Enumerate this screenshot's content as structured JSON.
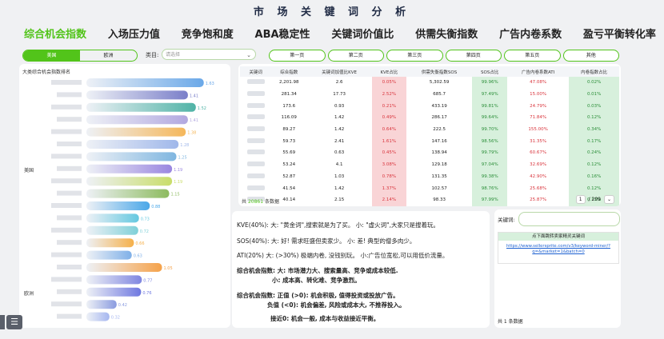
{
  "title": "市 场 关 键 词 分 析",
  "tabs": [
    "综合机会指数",
    "入场压力值",
    "竞争饱和度",
    "ABA稳定性",
    "关键词价值比",
    "供需失衡指数",
    "广告内卷系数",
    "盈亏平衡转化率"
  ],
  "region_toggle": [
    "美国",
    "欧洲"
  ],
  "category": {
    "label": "类目:",
    "placeholder": "请选择"
  },
  "pages": [
    "第一页",
    "第二页",
    "第三页",
    "第四页",
    "第五页",
    "其他"
  ],
  "colors": {
    "accent": "#52c41a",
    "pink": "#f9d4d6",
    "green": "#d7f0dc"
  },
  "chart_data": {
    "type": "bar",
    "orientation": "horizontal",
    "title": "大类综合机会指数排名",
    "groups": [
      {
        "label": "美国"
      },
      {
        "label": "欧洲"
      }
    ],
    "values": [
      1.63,
      1.41,
      1.52,
      1.41,
      1.38,
      1.28,
      1.25,
      1.19,
      1.19,
      1.15,
      0.88,
      0.73,
      0.72,
      0.66,
      0.63,
      1.05,
      0.77,
      0.76,
      0.42,
      0.32
    ],
    "xticks": [
      "0",
      "0.2",
      "0.4",
      "0.6",
      "0.8",
      "1",
      "1.2",
      "1.4",
      "1.6",
      "1.8"
    ],
    "xlim": [
      0,
      1.8
    ],
    "grid": false,
    "gradient_colors": [
      "#6aa8e8",
      "#7a7fc9",
      "#4fb3a6",
      "#b2a8e0",
      "#f5b75a",
      "#9fb7ea",
      "#7fb6e0",
      "#9a86e0",
      "#c9dd6a",
      "#8dbb5f",
      "#4aa7e8",
      "#64c8e0",
      "#7fd0d8",
      "#f5b04a",
      "#7fb0e8",
      "#f5a24a",
      "#7f86e0",
      "#6f78e0",
      "#8a9be0",
      "#a5b6f0"
    ]
  },
  "table": {
    "headers": [
      "关键词",
      "综合指数",
      "关键词加值比KVE",
      "KVE占比",
      "供需失衡指数SOS",
      "SOS占比",
      "广告内卷系数ATI",
      "内卷指数占比"
    ],
    "rows": [
      [
        "",
        "2,201.98",
        "2.6",
        "0.05%",
        "5,302.59",
        "99.96%",
        "47.08%",
        "0.02%"
      ],
      [
        "",
        "281.34",
        "17.73",
        "2.52%",
        "685.7",
        "97.49%",
        "15.00%",
        "0.01%"
      ],
      [
        "",
        "173.6",
        "0.93",
        "0.21%",
        "433.19",
        "99.81%",
        "24.79%",
        "0.03%"
      ],
      [
        "",
        "116.09",
        "1.42",
        "0.49%",
        "286.17",
        "99.64%",
        "71.84%",
        "0.12%"
      ],
      [
        "",
        "89.27",
        "1.42",
        "0.64%",
        "222.5",
        "99.70%",
        "155.00%",
        "0.34%"
      ],
      [
        "",
        "59.73",
        "2.41",
        "1.61%",
        "147.16",
        "98.56%",
        "31.35%",
        "0.17%"
      ],
      [
        "",
        "55.69",
        "0.63",
        "0.45%",
        "138.94",
        "99.79%",
        "60.67%",
        "0.24%"
      ],
      [
        "",
        "53.24",
        "4.1",
        "3.08%",
        "129.18",
        "97.04%",
        "32.69%",
        "0.12%"
      ],
      [
        "",
        "52.87",
        "1.03",
        "0.78%",
        "131.35",
        "99.38%",
        "42.90%",
        "0.16%"
      ],
      [
        "",
        "41.54",
        "1.42",
        "1.37%",
        "102.57",
        "98.76%",
        "25.68%",
        "0.12%"
      ],
      [
        "",
        "40.14",
        "2.15",
        "2.14%",
        "98.33",
        "97.99%",
        "25.87%",
        "0.13%"
      ]
    ],
    "footer_prefix": "共",
    "footer_count": "20861",
    "footer_suffix": "条数据",
    "pager_current": "1",
    "pager_total": "/ 209"
  },
  "explain": [
    "KVE(40%):  大: \"黄金词\",搜索就是为了买。          小: \"虚火词\",大家只是搜着玩。",
    "SOS(40%):  大: 好! 需求旺盛但卖家少。          小: 差! 典型的僧多肉少。",
    "ATI(20%)    大: (>30%) 极端内卷, 没钱别玩。    小:广告位宽松,可以用低价流量。",
    "综合机会指数: 大: 市场潜力大、搜索量高、竞争或成本较低.",
    "小: 成本高、转化难、竞争激烈。",
    "综合机会指数: 正值 (>0): 机会积极, 值得投资或投放广告。",
    "负值 (<0): 机会偏差, 风险或成本大, 不推荐投入。",
    "接近0: 机会一般, 成本与收益接近平衡。"
  ],
  "keyword_panel": {
    "label": "关键词:",
    "link_header": "点下面跳转卖家精灵关键词",
    "link": "https://www.sellersprite.com/v3/keyword-miner/?q=&market=1&batch=0",
    "footer": "共 1 条数据"
  },
  "menu_icon": "list-icon"
}
